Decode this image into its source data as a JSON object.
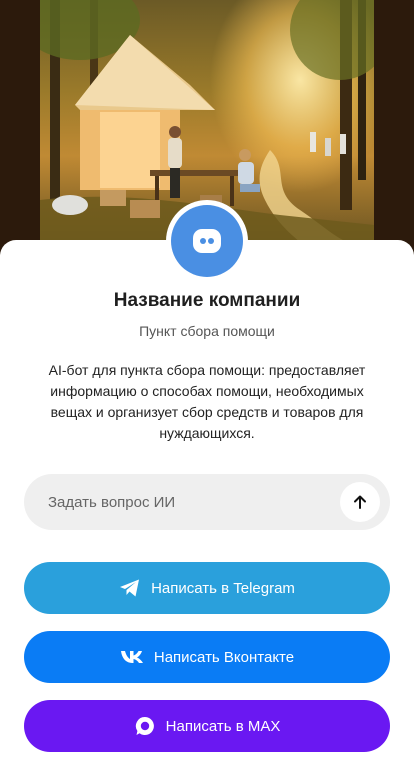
{
  "hero": {
    "image_name": "tent-in-forest-image"
  },
  "company": {
    "name": "Название компании",
    "subtitle": "Пункт сбора помощи",
    "description": "AI-бот для пункта сбора помощи: предоставляет информацию о способах помощи, необходимых вещах и организует сбор средств и товаров для нуждающихся."
  },
  "ask": {
    "placeholder": "Задать вопрос ИИ",
    "send_icon": "arrow-up-icon"
  },
  "buttons": {
    "telegram": {
      "label": "Написать в Telegram",
      "color": "#2aa0dc",
      "icon": "telegram-icon"
    },
    "vk": {
      "label": "Написать Вконтакте",
      "color": "#0a7cf5",
      "icon": "vk-icon"
    },
    "max": {
      "label": "Написать в MAX",
      "color": "#6a18f2",
      "icon": "max-icon"
    }
  },
  "colors": {
    "avatar": "#4a8fe3",
    "card_bg": "#ffffff"
  }
}
